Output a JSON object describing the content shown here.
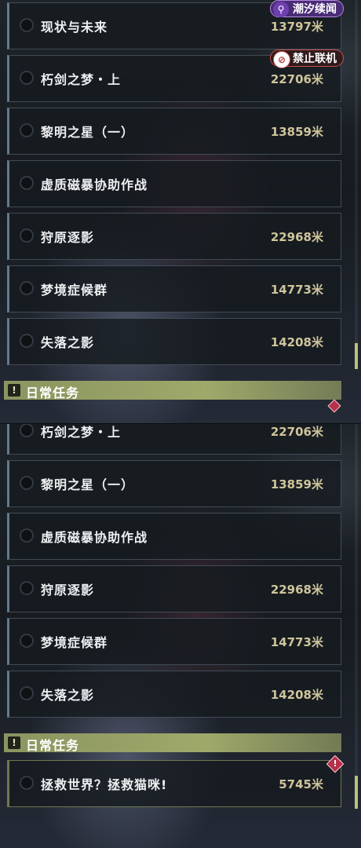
{
  "top_panel": {
    "tasks": [
      {
        "name": "现状与未来",
        "distance": "13797米"
      },
      {
        "name": "朽剑之梦・上",
        "distance": "22706米"
      },
      {
        "name": "黎明之星（一）",
        "distance": "13859米"
      },
      {
        "name": "虚质磁暴协助作战",
        "distance": ""
      },
      {
        "name": "狩原逐影",
        "distance": "22968米"
      },
      {
        "name": "梦境症候群",
        "distance": "14773米"
      },
      {
        "name": "失落之影",
        "distance": "14208米"
      }
    ],
    "section_title": "日常任务",
    "badges": {
      "tide": "潮汐续闻",
      "no_link": "禁止联机"
    }
  },
  "bottom_panel": {
    "tasks": [
      {
        "name": "朽剑之梦・上",
        "distance": "22706米"
      },
      {
        "name": "黎明之星（一）",
        "distance": "13859米"
      },
      {
        "name": "虚质磁暴协助作战",
        "distance": ""
      },
      {
        "name": "狩原逐影",
        "distance": "22968米"
      },
      {
        "name": "梦境症候群",
        "distance": "14773米"
      },
      {
        "name": "失落之影",
        "distance": "14208米"
      }
    ],
    "section_title": "日常任务",
    "daily_tasks": [
      {
        "name": "拯救世界？拯救猫咪!",
        "distance": "5745米"
      }
    ]
  },
  "icons": {
    "section": "exclamation-icon",
    "tide_badge": "tide-icon",
    "no_link_badge": "no-link-icon",
    "warning": "warning-diamond-icon"
  },
  "colors": {
    "accent": "#b9c27a",
    "distance_text": "#cfc49a",
    "section_bar": "#9fa96a",
    "tide_badge": "#4a2c76",
    "warning": "#b6304a"
  }
}
